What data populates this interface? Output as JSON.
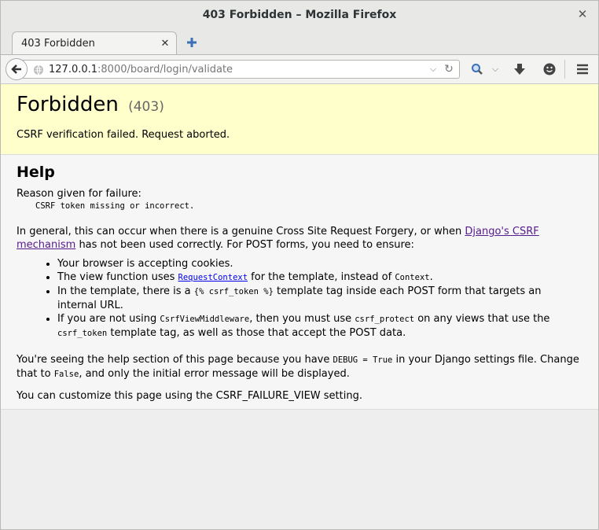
{
  "window": {
    "title": "403 Forbidden – Mozilla Firefox"
  },
  "tab": {
    "label": "403 Forbidden"
  },
  "urlbar": {
    "host": "127.0.0.1",
    "rest": ":8000/board/login/validate"
  },
  "summary": {
    "heading": "Forbidden",
    "code": "(403)",
    "message": "CSRF verification failed. Request aborted."
  },
  "help": {
    "heading": "Help",
    "reason_label": "Reason given for failure:",
    "reason": "CSRF token missing or incorrect.",
    "general_1": "In general, this can occur when there is a genuine Cross Site Request Forgery, or when ",
    "general_link": "Django's CSRF mechanism",
    "general_2": " has not been used correctly. For POST forms, you need to ensure:",
    "items": {
      "i1": "Your browser is accepting cookies.",
      "i2_a": "The view function uses ",
      "i2_link": "RequestContext",
      "i2_b": " for the template, instead of ",
      "i2_code": "Context",
      "i2_c": ".",
      "i3_a": "In the template, there is a ",
      "i3_code": "{% csrf_token %}",
      "i3_b": " template tag inside each POST form that targets an internal URL.",
      "i4_a": "If you are not using ",
      "i4_code1": "CsrfViewMiddleware",
      "i4_b": ", then you must use ",
      "i4_code2": "csrf_protect",
      "i4_c": " on any views that use the ",
      "i4_code3": "csrf_token",
      "i4_d": " template tag, as well as those that accept the POST data."
    },
    "debug_a": "You're seeing the help section of this page because you have ",
    "debug_code": "DEBUG = True",
    "debug_b": " in your Django settings file. Change that to ",
    "debug_code2": "False",
    "debug_c": ", and only the initial error message will be displayed.",
    "customize": "You can customize this page using the CSRF_FAILURE_VIEW setting."
  }
}
